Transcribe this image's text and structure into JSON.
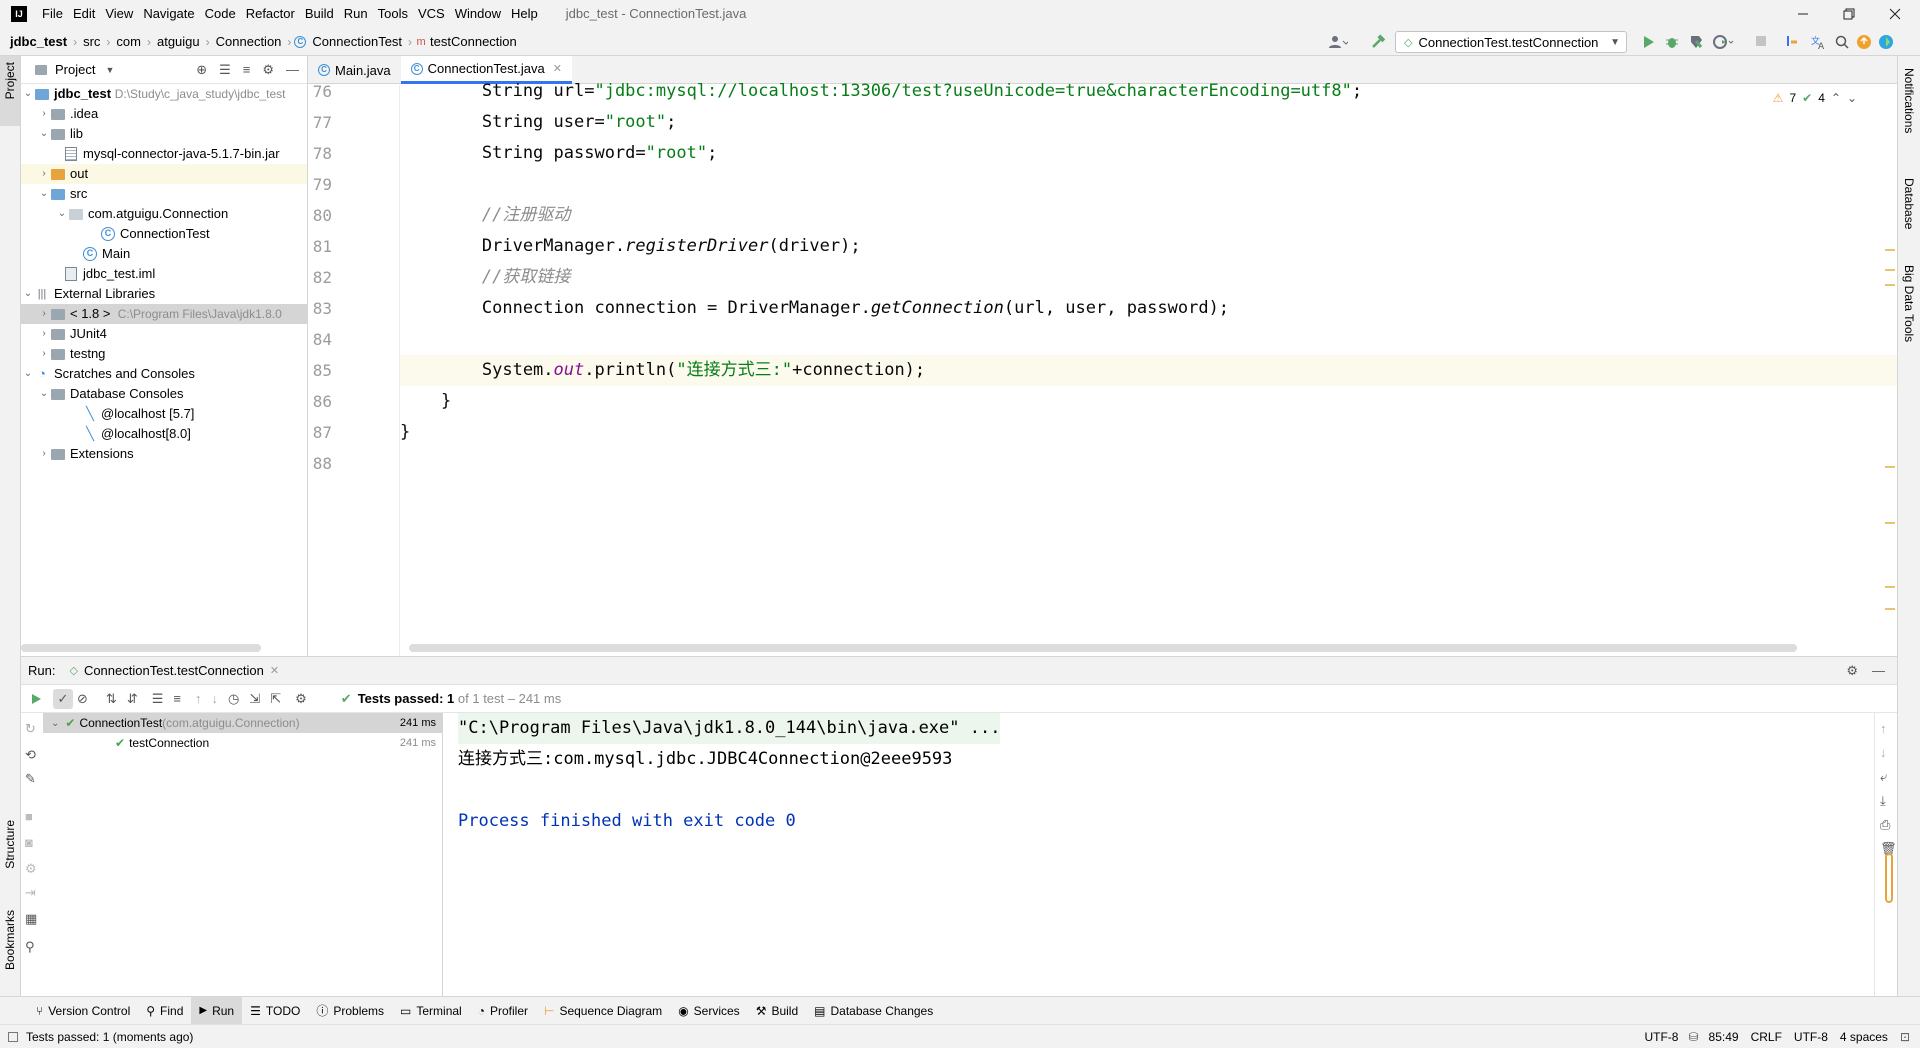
{
  "menubar": {
    "items": [
      "File",
      "Edit",
      "View",
      "Navigate",
      "Code",
      "Refactor",
      "Build",
      "Run",
      "Tools",
      "VCS",
      "Window",
      "Help"
    ],
    "window_title": "jdbc_test - ConnectionTest.java"
  },
  "breadcrumb": {
    "project": "jdbc_test",
    "parts": [
      "src",
      "com",
      "atguigu",
      "Connection",
      "ConnectionTest",
      "testConnection"
    ]
  },
  "run_config": {
    "label": "ConnectionTest.testConnection"
  },
  "left_strip": {
    "project": "Project",
    "structure": "Structure",
    "bookmarks": "Bookmarks"
  },
  "right_strip": {
    "notifications": "Notifications",
    "database": "Database",
    "big_data": "Big Data Tools"
  },
  "project_panel": {
    "title": "Project",
    "tree": [
      {
        "label": "jdbc_test",
        "hint": "D:\\Study\\c_java_study\\jdbc_test"
      },
      {
        "label": ".idea"
      },
      {
        "label": "lib"
      },
      {
        "label": "mysql-connector-java-5.1.7-bin.jar"
      },
      {
        "label": "out"
      },
      {
        "label": "src"
      },
      {
        "label": "com.atguigu.Connection"
      },
      {
        "label": "ConnectionTest"
      },
      {
        "label": "Main"
      },
      {
        "label": "jdbc_test.iml"
      },
      {
        "label": "External Libraries"
      },
      {
        "label": "< 1.8 >",
        "hint": "C:\\Program Files\\Java\\jdk1.8.0"
      },
      {
        "label": "JUnit4"
      },
      {
        "label": "testng"
      },
      {
        "label": "Scratches and Consoles"
      },
      {
        "label": "Database Consoles"
      },
      {
        "label": "@localhost [5.7]"
      },
      {
        "label": "@localhost[8.0]"
      },
      {
        "label": "Extensions"
      }
    ]
  },
  "editor": {
    "tabs": [
      "Main.java",
      "ConnectionTest.java"
    ],
    "inspections": {
      "warnings": "7",
      "checks": "4"
    },
    "lines": [
      {
        "n": "76",
        "pre": "        String url=",
        "str": "\"jdbc:mysql://localhost:13306/test?useUnicode=true&characterEncoding=utf8\"",
        "post": ";"
      },
      {
        "n": "77",
        "pre": "        String user=",
        "str": "\"root\"",
        "post": ";"
      },
      {
        "n": "78",
        "pre": "        String password=",
        "str": "\"root\"",
        "post": ";"
      },
      {
        "n": "79"
      },
      {
        "n": "80",
        "comment": "        //注册驱动"
      },
      {
        "n": "81",
        "pre": "        DriverManager.",
        "italic": "registerDriver",
        "post": "(driver);"
      },
      {
        "n": "82",
        "comment": "        //获取链接"
      },
      {
        "n": "83",
        "pre": "        Connection connection = DriverManager.",
        "italic": "getConnection",
        "post": "(url, user, password);"
      },
      {
        "n": "84"
      },
      {
        "n": "85",
        "pre": "        System.",
        "field": "out",
        "mid": ".println(",
        "str": "\"连接方式三:\"",
        "post": "+connection);"
      },
      {
        "n": "86",
        "pre": "    }"
      },
      {
        "n": "87",
        "pre": "}"
      },
      {
        "n": "88"
      }
    ]
  },
  "run_panel": {
    "label": "Run:",
    "tab": "ConnectionTest.testConnection",
    "status_bold": "Tests passed: 1",
    "status_rest": " of 1 test – 241 ms",
    "tests": [
      {
        "name": "ConnectionTest",
        "pkg": " (com.atguigu.Connection)",
        "time": "241 ms"
      },
      {
        "name": "testConnection",
        "time": "241 ms"
      }
    ],
    "console": [
      "\"C:\\Program Files\\Java\\jdk1.8.0_144\\bin\\java.exe\" ...",
      "连接方式三:com.mysql.jdbc.JDBC4Connection@2eee9593",
      "",
      "Process finished with exit code 0"
    ]
  },
  "bottom_tabs": [
    "Version Control",
    "Find",
    "Run",
    "TODO",
    "Problems",
    "Terminal",
    "Profiler",
    "Sequence Diagram",
    "Services",
    "Build",
    "Database Changes"
  ],
  "statusbar": {
    "left": "Tests passed: 1 (moments ago)",
    "right": [
      "UTF-8",
      "85:49",
      "CRLF",
      "UTF-8",
      "4 spaces"
    ]
  }
}
